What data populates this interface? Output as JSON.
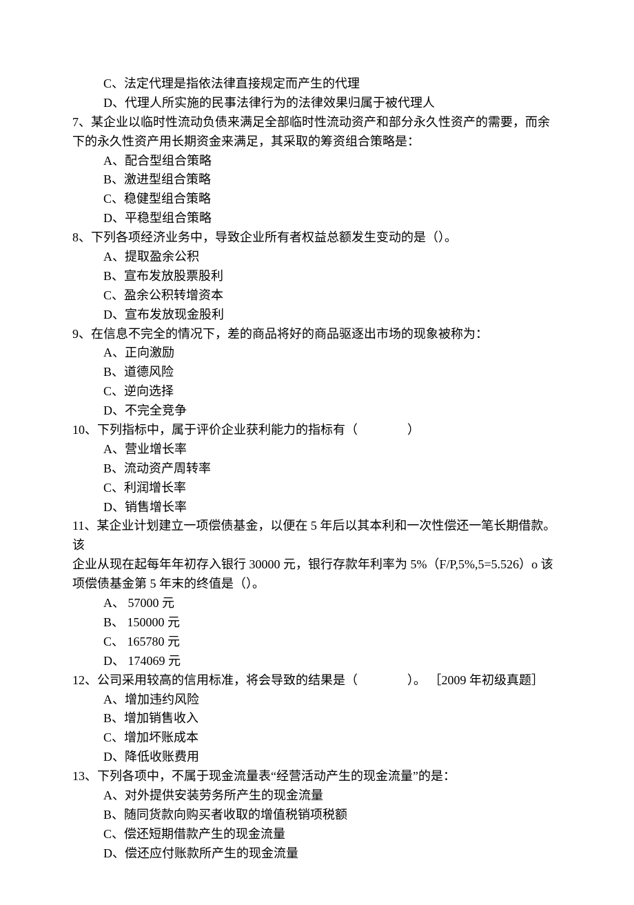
{
  "lines": [
    {
      "cls": "option-line",
      "text": "C、法定代理是指依法律直接规定而产生的代理"
    },
    {
      "cls": "option-line",
      "text": "D、代理人所实施的民事法律行为的法律效果归属于被代理人"
    },
    {
      "cls": "question-line",
      "text": "7、某企业以临时性流动负债来满足全部临时性流动资产和部分永久性资产的需要，而余下的永久性资产用长期资金来满足，其采取的筹资组合策略是："
    },
    {
      "cls": "option-line",
      "text": "A、配合型组合策略"
    },
    {
      "cls": "option-line",
      "text": "B、激进型组合策略"
    },
    {
      "cls": "option-line",
      "text": "C、稳健型组合策略"
    },
    {
      "cls": "option-line",
      "text": "D、平稳型组合策略"
    },
    {
      "cls": "question-line",
      "text": "8、下列各项经济业务中，导致企业所有者权益总额发生变动的是（）。"
    },
    {
      "cls": "option-line",
      "text": "A、提取盈余公积"
    },
    {
      "cls": "option-line",
      "text": "B、宣布发放股票股利"
    },
    {
      "cls": "option-line",
      "text": "C、盈余公积转增资本"
    },
    {
      "cls": "option-line",
      "text": "D、宣布发放现金股利"
    },
    {
      "cls": "question-line",
      "text": "9、在信息不完全的情况下，差的商品将好的商品驱逐出市场的现象被称为："
    },
    {
      "cls": "option-line",
      "text": "A、正向激励"
    },
    {
      "cls": "option-line",
      "text": "B、道德风险"
    },
    {
      "cls": "option-line",
      "text": "C、逆向选择"
    },
    {
      "cls": "option-line",
      "text": "D、不完全竞争"
    },
    {
      "cls": "question-line",
      "text": "10、下列指标中，属于评价企业获利能力的指标有（　　　　）"
    },
    {
      "cls": "option-line",
      "text": "A、营业增长率"
    },
    {
      "cls": "option-line",
      "text": "B、流动资产周转率"
    },
    {
      "cls": "option-line",
      "text": "C、利润增长率"
    },
    {
      "cls": "option-line",
      "text": "D、销售增长率"
    },
    {
      "cls": "question-line",
      "text": "11、某企业计划建立一项偿债基金，以便在 5 年后以其本利和一次性偿还一笔长期借款。该"
    },
    {
      "cls": "cont-line",
      "text": "企业从现在起每年年初存入银行 30000 元，银行存款年利率为 5%（F/P,5%,5=5.526）o 该"
    },
    {
      "cls": "cont-line",
      "text": "项偿债基金第 5 年末的终值是（）。"
    },
    {
      "cls": "option-line",
      "text": "A、 57000 元"
    },
    {
      "cls": "option-line",
      "text": "B、 150000 元"
    },
    {
      "cls": "option-line",
      "text": "C、 165780 元"
    },
    {
      "cls": "option-line",
      "text": "D、 174069 元"
    },
    {
      "cls": "question-line",
      "text": "12、公司采用较高的信用标准，将会导致的结果是（　　　　）。 ［2009 年初级真题］"
    },
    {
      "cls": "option-line",
      "text": "A、增加违约风险"
    },
    {
      "cls": "option-line",
      "text": "B、增加销售收入"
    },
    {
      "cls": "option-line",
      "text": "C、增加坏账成本"
    },
    {
      "cls": "option-line",
      "text": "D、降低收账费用"
    },
    {
      "cls": "question-line",
      "text": "13、下列各项中，不属于现金流量表“经营活动产生的现金流量”的是："
    },
    {
      "cls": "option-line",
      "text": "A、对外提供安装劳务所产生的现金流量"
    },
    {
      "cls": "option-line",
      "text": "B、随同货款向购买者收取的增值税销项税额"
    },
    {
      "cls": "option-line",
      "text": "C、偿还短期借款产生的现金流量"
    },
    {
      "cls": "option-line",
      "text": "D、偿还应付账款所产生的现金流量"
    }
  ]
}
